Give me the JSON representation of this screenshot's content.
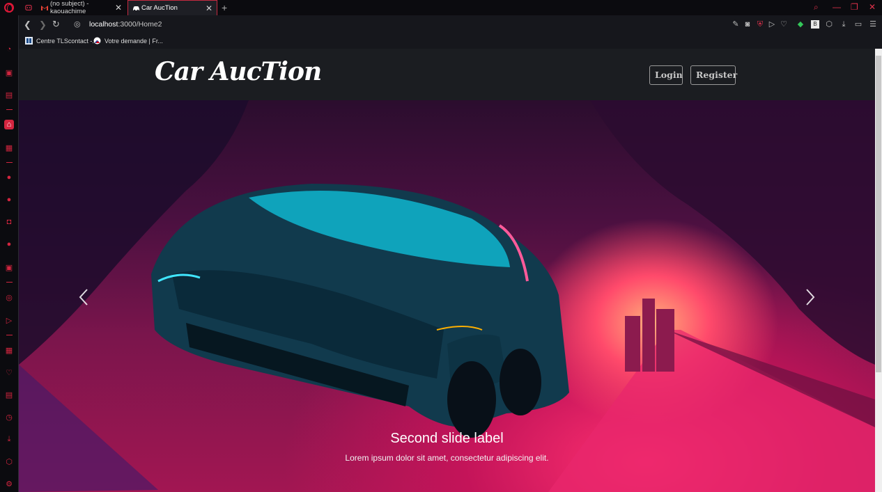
{
  "browser": {
    "tabs": [
      {
        "label": "(no subject) - kaouachime"
      },
      {
        "label": "Car AucTion"
      }
    ],
    "url_host": "localhost",
    "url_path": ":3000/Home2",
    "bookmarks": [
      {
        "label": "Centre TLScontact -..."
      },
      {
        "label": "Votre demande | Fr..."
      }
    ],
    "accent": "#d3253f"
  },
  "site": {
    "brand": "Car AucTion",
    "login_label": "Login",
    "register_label": "Register"
  },
  "carousel": {
    "caption_title": "Second slide label",
    "caption_text": "Lorem ipsum dolor sit amet, consectetur adipiscing elit."
  }
}
